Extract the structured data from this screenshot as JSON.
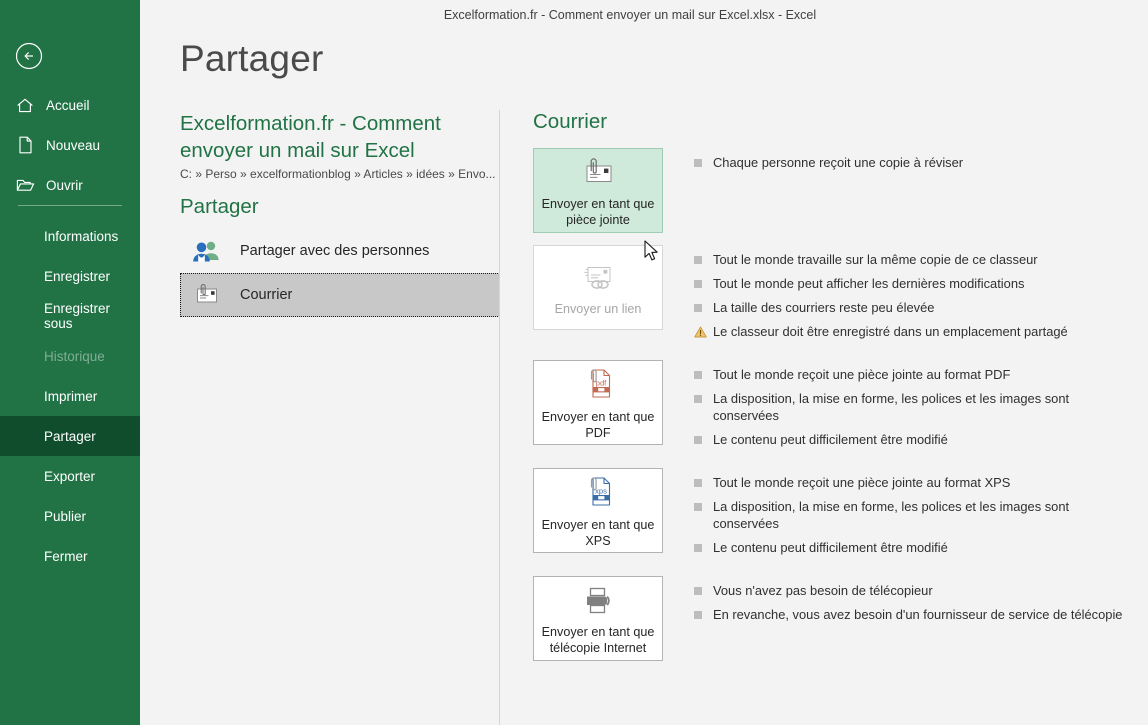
{
  "window": {
    "titlebar_text": "Excelformation.fr - Comment envoyer un mail sur Excel.xlsx  -  Excel"
  },
  "backstage": {
    "page_title": "Partager",
    "back_icon": "back-arrow-icon"
  },
  "sidebar": {
    "top_items": [
      {
        "label": "Accueil",
        "icon": "home-icon"
      },
      {
        "label": "Nouveau",
        "icon": "new-document-icon"
      },
      {
        "label": "Ouvrir",
        "icon": "open-folder-icon"
      }
    ],
    "items": [
      {
        "label": "Informations",
        "state": "normal"
      },
      {
        "label": "Enregistrer",
        "state": "normal"
      },
      {
        "label": "Enregistrer sous",
        "state": "normal"
      },
      {
        "label": "Historique",
        "state": "disabled"
      },
      {
        "label": "Imprimer",
        "state": "normal"
      },
      {
        "label": "Partager",
        "state": "selected"
      },
      {
        "label": "Exporter",
        "state": "normal"
      },
      {
        "label": "Publier",
        "state": "normal"
      },
      {
        "label": "Fermer",
        "state": "normal"
      }
    ]
  },
  "document": {
    "title": "Excelformation.fr - Comment envoyer un mail sur Excel",
    "path": "C: » Perso » excelformationblog » Articles » idées » Envo..."
  },
  "share": {
    "heading": "Partager",
    "options": [
      {
        "label": "Partager avec des personnes",
        "icon": "people-share-icon",
        "state": "normal"
      },
      {
        "label": "Courrier",
        "icon": "mail-attachment-icon",
        "state": "active"
      }
    ]
  },
  "mail": {
    "heading": "Courrier",
    "groups": [
      {
        "tile_label": "Envoyer en tant que pièce jointe",
        "icon": "mail-attachment-icon",
        "state": "highlighted",
        "bullets": [
          {
            "text": "Chaque personne reçoit une copie à réviser",
            "type": "square"
          }
        ]
      },
      {
        "tile_label": "Envoyer un lien",
        "icon": "mail-link-icon",
        "state": "disabled",
        "bullets": [
          {
            "text": "Tout le monde travaille sur la même copie de ce classeur",
            "type": "square"
          },
          {
            "text": "Tout le monde peut afficher les dernières modifications",
            "type": "square"
          },
          {
            "text": "La taille des courriers reste peu élevée",
            "type": "square"
          },
          {
            "text": "Le classeur doit être enregistré dans un emplacement partagé",
            "type": "warning"
          }
        ]
      },
      {
        "tile_label": "Envoyer en tant que PDF",
        "icon": "pdf-attachment-icon",
        "state": "normal",
        "bullets": [
          {
            "text": "Tout le monde reçoit une pièce jointe au format PDF",
            "type": "square"
          },
          {
            "text": "La disposition, la mise en forme, les polices et les images sont conservées",
            "type": "square"
          },
          {
            "text": "Le contenu peut difficilement être modifié",
            "type": "square"
          }
        ]
      },
      {
        "tile_label": "Envoyer en tant que XPS",
        "icon": "xps-attachment-icon",
        "state": "normal",
        "bullets": [
          {
            "text": "Tout le monde reçoit une pièce jointe au format XPS",
            "type": "square"
          },
          {
            "text": "La disposition, la mise en forme, les polices et les images sont conservées",
            "type": "square"
          },
          {
            "text": "Le contenu peut difficilement être modifié",
            "type": "square"
          }
        ]
      },
      {
        "tile_label": "Envoyer en tant que télécopie Internet",
        "icon": "fax-icon",
        "state": "normal",
        "bullets": [
          {
            "text": "Vous n'avez pas besoin de télécopieur",
            "type": "square"
          },
          {
            "text": "En revanche, vous avez besoin d'un fournisseur de service de télécopie",
            "type": "square"
          }
        ]
      }
    ]
  },
  "colors": {
    "brand_green": "#217346",
    "selected_green": "#0f4d2c",
    "highlight_tile": "#cfe9da",
    "page_bg": "#f3f3f3"
  }
}
